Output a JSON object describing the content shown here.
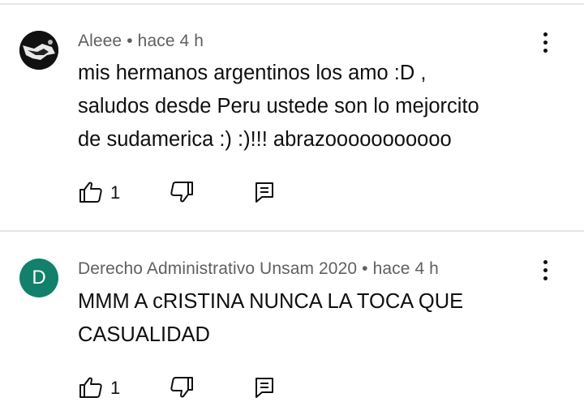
{
  "comments": [
    {
      "author": "Aleee",
      "time": "hace 4 h",
      "text_lines": [
        "mis hermanos argentinos los amo :D ,",
        "saludos desde Peru ustede son lo mejorcito",
        "de sudamerica :) :)!!! abrazooooooooooo"
      ],
      "likes": "1",
      "avatar": {
        "type": "image",
        "icon": "profile-image"
      }
    },
    {
      "author": "Derecho Administrativo Unsam 2020",
      "time": "hace 4 h",
      "text_lines": [
        "MMM A cRISTINA NUNCA LA TOCA QUE",
        "CASUALIDAD"
      ],
      "likes": "1",
      "avatar": {
        "type": "letter",
        "letter": "D",
        "color": "#12806b"
      }
    }
  ],
  "meta_separator": "•",
  "icons": {
    "like": "thumbs-up-icon",
    "dislike": "thumbs-down-icon",
    "reply": "reply-icon",
    "more": "more-vertical-icon"
  }
}
